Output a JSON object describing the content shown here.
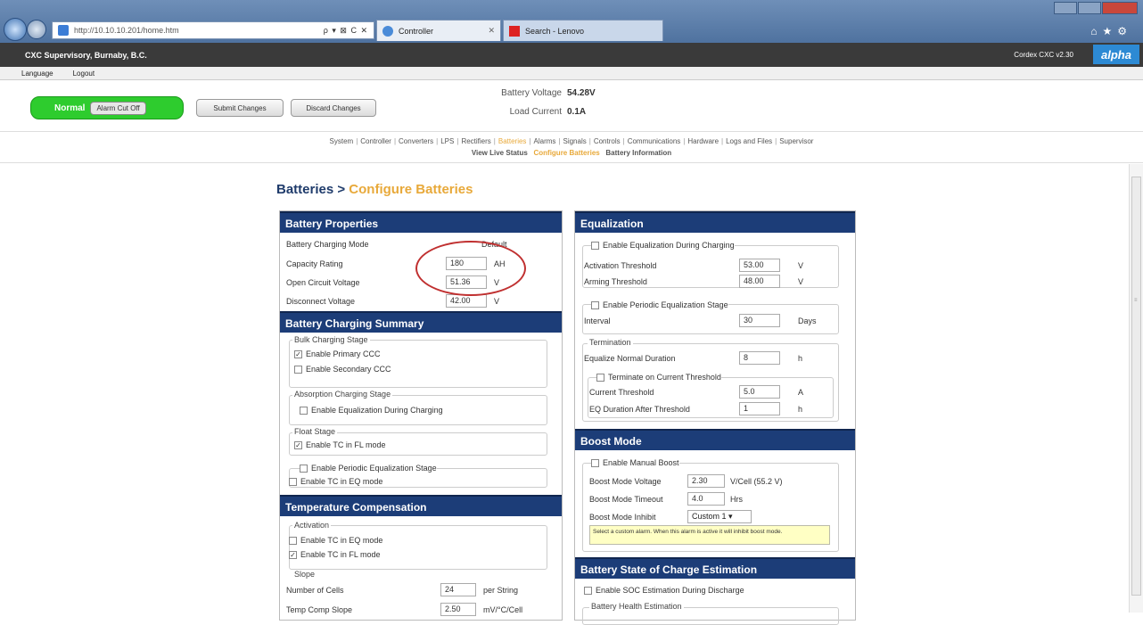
{
  "browser": {
    "url": "http://10.10.10.201/home.htm",
    "tab1_title": "Controller",
    "tab2_title": "Search - Lenovo",
    "address_controls": "ρ ▾ ⊠ C ✕"
  },
  "app": {
    "site_name": "CXC Supervisory, Burnaby, B.C.",
    "version": "Cordex CXC v2.30",
    "logo": "alpha",
    "subnav": {
      "language": "Language",
      "logout": "Logout"
    }
  },
  "status": {
    "state": "Normal",
    "alarm_cutoff": "Alarm Cut Off",
    "submit": "Submit Changes",
    "discard": "Discard Changes",
    "battery_voltage_label": "Battery Voltage",
    "battery_voltage": "54.28V",
    "load_current_label": "Load Current",
    "load_current": "0.1A"
  },
  "nav": {
    "items": [
      "System",
      "Controller",
      "Converters",
      "LPS",
      "Rectifiers",
      "Batteries",
      "Alarms",
      "Signals",
      "Controls",
      "Communications",
      "Hardware",
      "Logs and Files",
      "Supervisor"
    ],
    "active_index": 5,
    "sub": {
      "live": "View Live Status",
      "configure": "Configure Batteries",
      "info": "Battery Information"
    }
  },
  "page": {
    "crumb_parent": "Batteries > ",
    "crumb_current": "Configure Batteries"
  },
  "battery_properties": {
    "title": "Battery Properties",
    "charging_mode_label": "Battery Charging Mode",
    "charging_mode_value": "Default",
    "capacity_label": "Capacity Rating",
    "capacity_value": "180",
    "capacity_unit": "AH",
    "ocv_label": "Open Circuit Voltage",
    "ocv_value": "51.36",
    "ocv_unit": "V",
    "disconnect_label": "Disconnect Voltage",
    "disconnect_value": "42.00",
    "disconnect_unit": "V"
  },
  "charging_summary": {
    "title": "Battery Charging Summary",
    "bulk": "Bulk Charging Stage",
    "primary_ccc": "Enable Primary CCC",
    "secondary_ccc": "Enable Secondary CCC",
    "absorption": "Absorption Charging Stage",
    "eq_during": "Enable Equalization During Charging",
    "float": "Float Stage",
    "tc_fl": "Enable TC in FL mode",
    "periodic_eq": "Enable Periodic Equalization Stage",
    "tc_eq": "Enable TC in EQ mode"
  },
  "temp_comp": {
    "title": "Temperature Compensation",
    "activation": "Activation",
    "tc_eq": "Enable TC in EQ mode",
    "tc_fl": "Enable TC in FL mode",
    "slope": "Slope",
    "cells_label": "Number of Cells",
    "cells_value": "24",
    "cells_unit": "per String",
    "slope_label": "Temp Comp Slope",
    "slope_value": "2.50",
    "slope_unit": "mV/°C/Cell"
  },
  "equalization": {
    "title": "Equalization",
    "enable_eq": "Enable Equalization During Charging",
    "activation_label": "Activation Threshold",
    "activation_value": "53.00",
    "activation_unit": "V",
    "arming_label": "Arming Threshold",
    "arming_value": "48.00",
    "arming_unit": "V",
    "periodic": "Enable Periodic Equalization Stage",
    "interval_label": "Interval",
    "interval_value": "30",
    "interval_unit": "Days",
    "termination": "Termination",
    "normal_dur_label": "Equalize Normal Duration",
    "normal_dur_value": "8",
    "normal_dur_unit": "h",
    "term_current": "Terminate on Current Threshold",
    "cur_thresh_label": "Current Threshold",
    "cur_thresh_value": "5.0",
    "cur_thresh_unit": "A",
    "eq_after_label": "EQ Duration After Threshold",
    "eq_after_value": "1",
    "eq_after_unit": "h"
  },
  "boost": {
    "title": "Boost Mode",
    "manual": "Enable Manual Boost",
    "voltage_label": "Boost Mode Voltage",
    "voltage_value": "2.30",
    "voltage_unit": "V/Cell (55.2 V)",
    "timeout_label": "Boost Mode Timeout",
    "timeout_value": "4.0",
    "timeout_unit": "Hrs",
    "inhibit_label": "Boost Mode Inhibit",
    "inhibit_value": "Custom 1",
    "tooltip": "Select a custom alarm. When this alarm is active it will inhibit boost mode."
  },
  "soc": {
    "title": "Battery State of Charge Estimation",
    "enable": "Enable SOC Estimation During Discharge",
    "health": "Battery Health Estimation"
  }
}
